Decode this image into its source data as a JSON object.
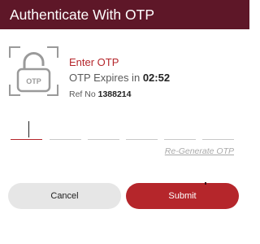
{
  "header": {
    "title": "Authenticate With OTP"
  },
  "lock": {
    "label": "OTP",
    "icon": "otp-lock-icon"
  },
  "otp_info": {
    "title": "Enter OTP",
    "expires_prefix": "OTP Expires in",
    "expires_time": "02:52",
    "ref_prefix": "Ref No",
    "ref_number": "1388214"
  },
  "otp_digits": [
    "",
    "",
    "",
    "",
    "",
    ""
  ],
  "regenerate_label": "Re-Generate OTP",
  "buttons": {
    "cancel": "Cancel",
    "submit": "Submit"
  },
  "colors": {
    "header_bg": "#5e1728",
    "accent": "#b5262b",
    "cancel_bg": "#e6e6e6"
  }
}
